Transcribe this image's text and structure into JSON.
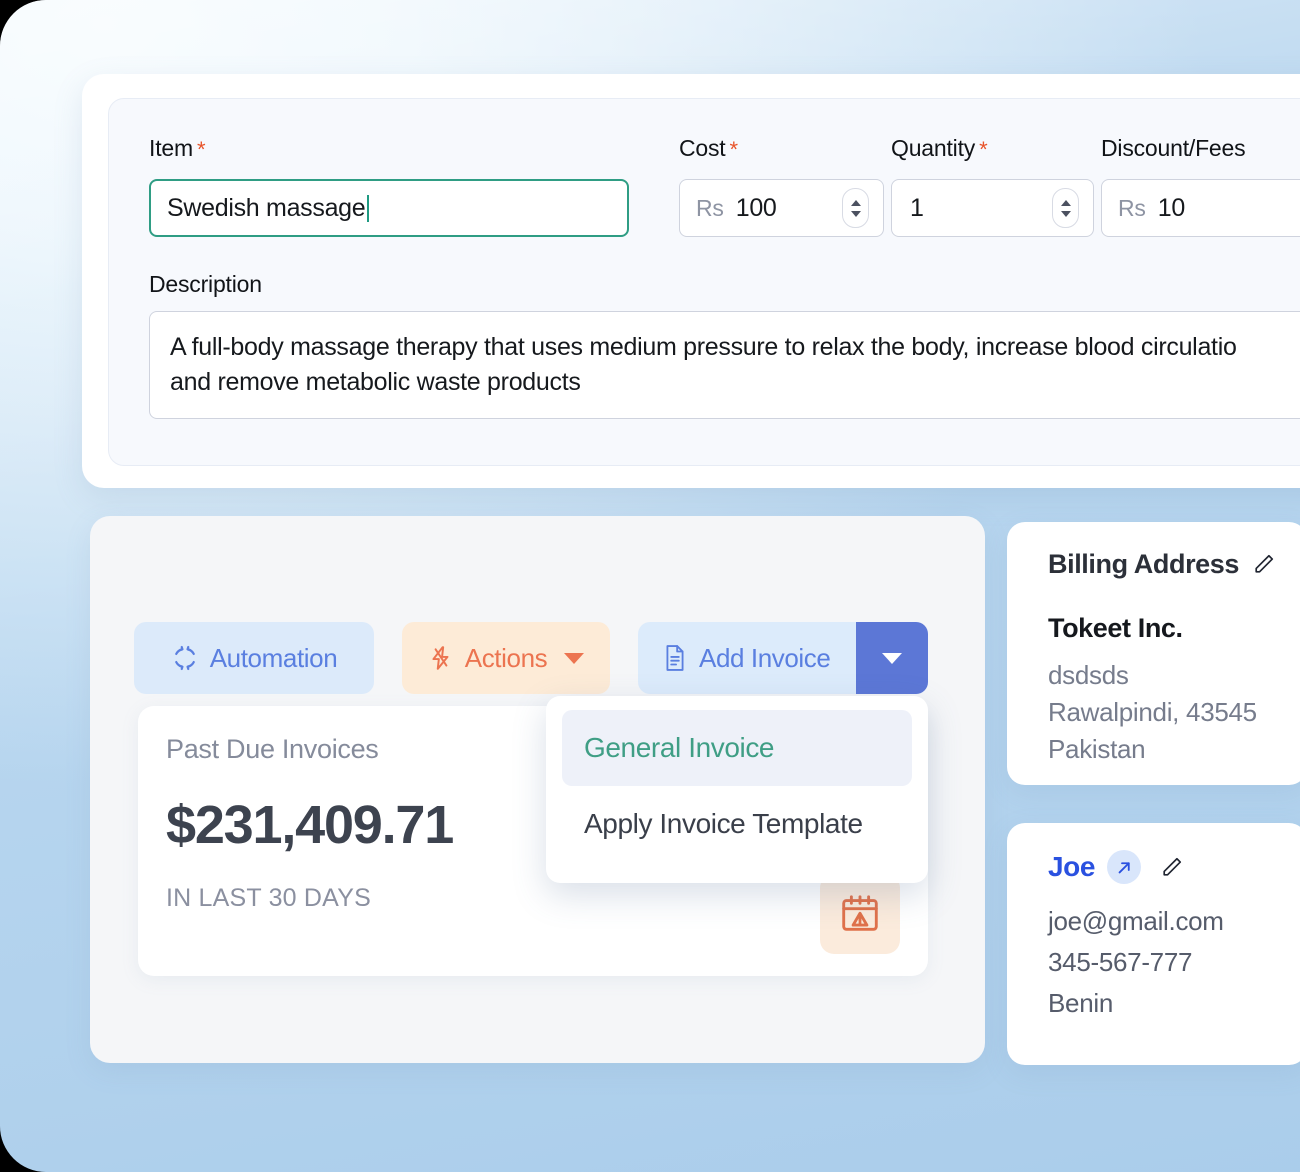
{
  "item_form": {
    "item": {
      "label": "Item",
      "required_marker": "*",
      "value": "Swedish massage"
    },
    "cost": {
      "label": "Cost",
      "required_marker": "*",
      "currency_prefix": "Rs",
      "value": "100"
    },
    "quantity": {
      "label": "Quantity",
      "required_marker": "*",
      "value": "1"
    },
    "discount_fees": {
      "label": "Discount/Fees",
      "currency_prefix": "Rs",
      "value": "10"
    },
    "description": {
      "label": "Description",
      "value": "A full-body massage therapy that uses medium pressure to relax the body, increase blood circulatio\nand remove metabolic waste products"
    }
  },
  "toolbar": {
    "automation_label": "Automation",
    "automation_icon": "automation-refresh-icon",
    "actions_label": "Actions",
    "actions_icon": "lightning-bolt-icon",
    "add_invoice_label": "Add Invoice",
    "add_invoice_icon": "document-icon",
    "dropdown_caret_icon": "chevron-down-icon"
  },
  "dropdown": {
    "items": [
      {
        "label": "General Invoice",
        "state": "active"
      },
      {
        "label": "Apply Invoice Template",
        "state": "normal"
      }
    ]
  },
  "stat_card": {
    "title": "Past Due Invoices",
    "value": "$231,409.71",
    "subtitle": "IN LAST 30 DAYS",
    "icon": "calendar-warning-icon"
  },
  "billing_address": {
    "heading": "Billing Address",
    "edit_icon": "pencil-icon",
    "company": "Tokeet Inc.",
    "line1": "dsdsds",
    "line2": "Rawalpindi, 43545",
    "line3": "Pakistan"
  },
  "contact": {
    "name": "Joe",
    "open_icon": "external-link-icon",
    "edit_icon": "pencil-icon",
    "email": "joe@gmail.com",
    "phone": "345-567-777",
    "country": "Benin"
  },
  "colors": {
    "accent_blue": "#5a7fe0",
    "accent_blue_solid": "#5c77d6",
    "accent_orange": "#ec7450",
    "accent_green": "#3f9e85",
    "focus_green": "#2f9d84",
    "required_red": "#e8542a",
    "link_blue": "#2a51e0"
  }
}
